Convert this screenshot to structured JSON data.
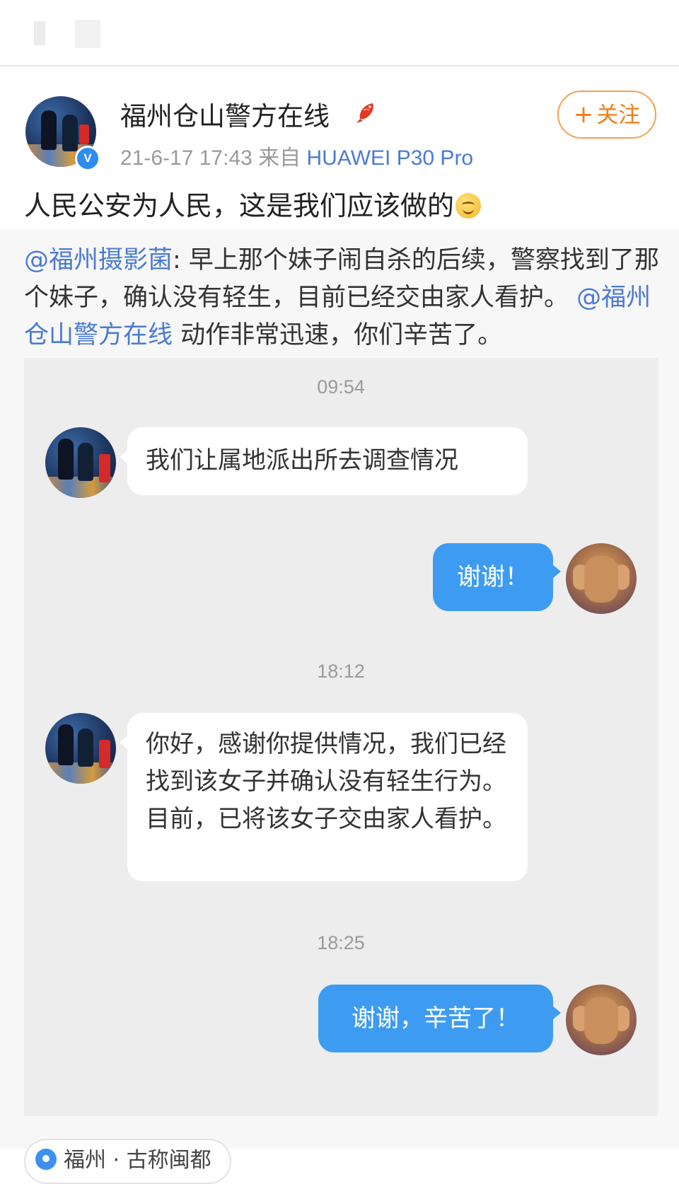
{
  "post": {
    "account_name": "福州仓山警方在线",
    "meta_date": "21-6-17 17:43",
    "meta_from": "来自",
    "meta_device": "HUAWEI P30 Pro",
    "follow_plus": "+",
    "follow_label": "关注",
    "verified_mark": "V",
    "text": "人民公安为人民，这是我们应该做的"
  },
  "repost": {
    "mention_1": "@福州摄影菌",
    "text_1": ": 早上那个妹子闹自杀的后续，警察找到了那个妹子，确认没有轻生，目前已经交由家人看护。",
    "mention_2": "@福州仓山警方在线",
    "text_2": " 动作非常迅速，你们辛苦了。"
  },
  "chat": {
    "time_1": "09:54",
    "msg_1": "我们让属地派出所去调查情况",
    "reply_1": "谢谢！",
    "time_2": "18:12",
    "msg_2": "你好，感谢你提供情况，我们已经找到该女子并确认没有轻生行为。目前，已将该女子交由家人看护。",
    "time_3": "18:25",
    "reply_2": "谢谢，辛苦了！"
  },
  "location": {
    "label": "福州 · 古称闽都"
  },
  "colors": {
    "link_blue": "#4b7bd1",
    "follow_orange": "#f07d1a",
    "bubble_blue": "#3d9cf2"
  }
}
